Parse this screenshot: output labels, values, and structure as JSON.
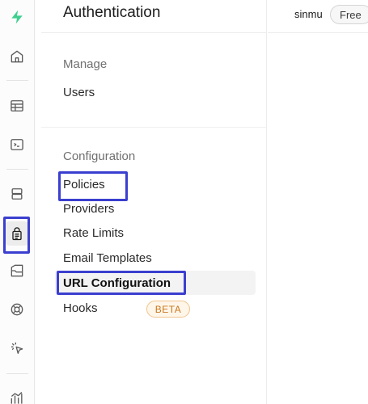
{
  "rail": {
    "items": [
      {
        "name": "supabase-logo-icon"
      },
      {
        "name": "home-icon"
      },
      {
        "name": "table-editor-icon"
      },
      {
        "name": "sql-editor-icon"
      },
      {
        "name": "database-icon"
      },
      {
        "name": "authentication-icon",
        "active": true
      },
      {
        "name": "storage-icon"
      },
      {
        "name": "realtime-icon"
      },
      {
        "name": "edge-functions-icon"
      },
      {
        "name": "reports-icon"
      }
    ],
    "brand_color": "#3ecf8e",
    "icon_color": "#5a5a5a"
  },
  "nav": {
    "title": "Authentication",
    "manage_label": "Manage",
    "users": "Users",
    "configuration_label": "Configuration",
    "policies": "Policies",
    "providers": "Providers",
    "rate_limits": "Rate Limits",
    "email_templates": "Email Templates",
    "url_configuration": "URL Configuration",
    "hooks": "Hooks",
    "beta_badge": "BETA"
  },
  "topbar": {
    "user": "sinmu",
    "plan": "Free"
  },
  "annotations": {
    "highlight_color": "#3b3fcf"
  }
}
